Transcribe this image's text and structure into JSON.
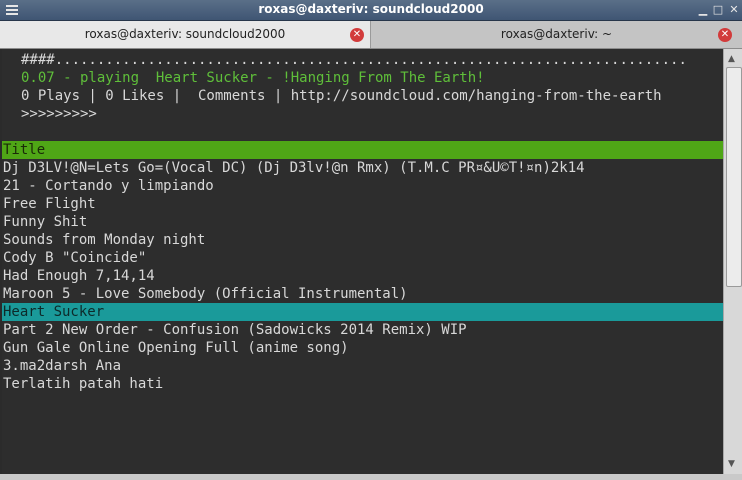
{
  "window": {
    "title": "roxas@daxteriv: soundcloud2000"
  },
  "tabs": [
    {
      "label": "roxas@daxteriv: soundcloud2000",
      "active": true
    },
    {
      "label": "roxas@daxteriv: ~",
      "active": false
    }
  ],
  "player": {
    "progress_line": "####...........................................................................",
    "now_playing": "0.07 - playing  Heart Sucker - !Hanging From The Earth!",
    "stats": "0 Plays | 0 Likes |  Comments | http://soundcloud.com/hanging-from-the-earth",
    "prompt": ">>>>>>>>>"
  },
  "list": {
    "header": "Title",
    "tracks": [
      "Dj D3LV!@N=Lets Go=(Vocal DC) (Dj D3lv!@n Rmx) (T.M.C PR¤&U©T!¤n)2k14",
      "21 - Cortando y limpiando",
      "Free Flight",
      "Funny Shit",
      "Sounds from Monday night",
      "Cody B \"Coincide\"",
      "Had Enough 7,14,14",
      "Maroon 5 - Love Somebody (Official Instrumental)",
      "Heart Sucker",
      "Part 2 New Order - Confusion (Sadowicks 2014 Remix) WIP",
      "Gun Gale Online Opening Full (anime song)",
      "3.ma2darsh Ana",
      "Terlatih patah hati"
    ],
    "selected_index": 8
  },
  "colors": {
    "header_bg": "#4fa616",
    "selected_bg": "#1a9a9a",
    "playing_text": "#5fbf3a"
  },
  "icons": {
    "window_menu": "hamburger-icon",
    "minimize": "minimize-icon",
    "maximize": "maximize-icon",
    "close": "close-icon",
    "tab_close": "tab-close-icon"
  }
}
